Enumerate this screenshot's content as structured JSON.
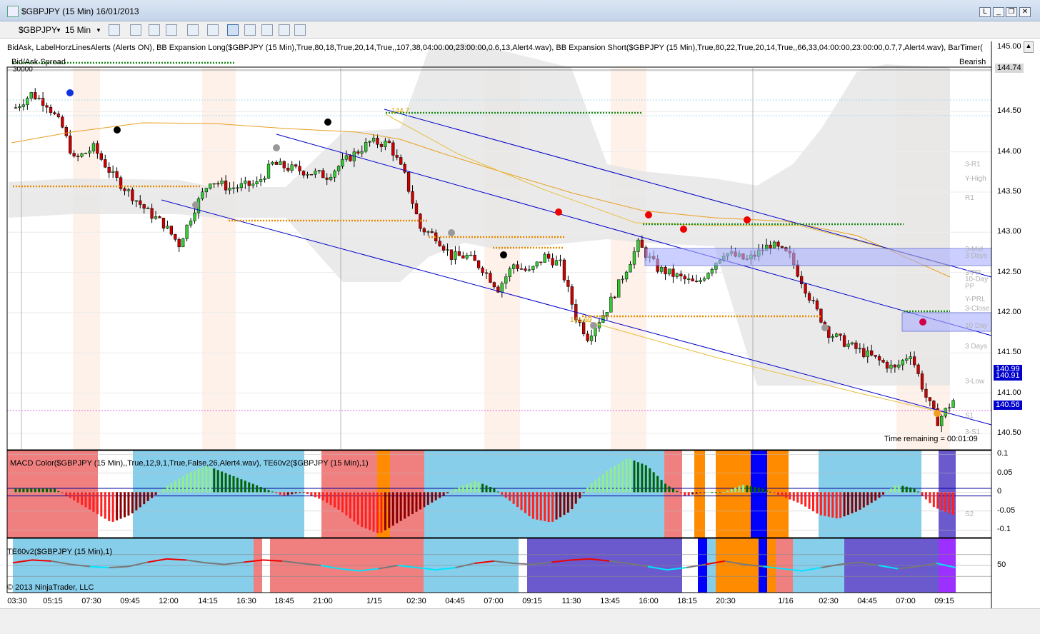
{
  "window": {
    "title": "$GBPJPY (15 Min)  16/01/2013",
    "controls": [
      "L",
      "_",
      "❐",
      "✕"
    ]
  },
  "toolbar": {
    "instrument": "$GBPJPY",
    "interval": "15 Min"
  },
  "chart_info": {
    "indicators": "BidAsk, LabelHorzLinesAlerts (Alerts ON), BB Expansion Long($GBPJPY (15 Min),True,80,18,True,20,14,True,,107,38,04:00:00,23:00:00,0.6,13,Alert4.wav), BB Expansion Short($GBPJPY (15 Min),True,80,22,True,20,14,True,,66,33,04:00:00,23:00:00,0.7,7,Alert4.wav), BarTimer(",
    "bidask_label": "Bid/Ask Spread",
    "bias_label": "Bearish",
    "overlay_value": "30000",
    "time_remaining": "Time remaining = 00:01:09",
    "macd_label": "MACD Color($GBPJPY (15 Min),,True,12,9,1,True,False,26,Alert4.wav), TE60v2($GBPJPY (15 Min),1)",
    "te_label": "TE60v2($GBPJPY (15 Min),1)",
    "copyright": "© 2013 NinjaTrader, LLC",
    "annotations": [
      {
        "text": "144.7",
        "series": "high"
      },
      {
        "text": "141.69",
        "series": "low"
      }
    ],
    "pivot_labels": [
      {
        "text": "3-R1",
        "price": 143.84
      },
      {
        "text": "Y-High",
        "price": 143.66
      },
      {
        "text": "R1",
        "price": 143.42
      },
      {
        "text": "3-Mid",
        "price": 142.78
      },
      {
        "text": "3 Days",
        "price": 142.7
      },
      {
        "text": "3-PP",
        "price": 142.49
      },
      {
        "text": "10-Day",
        "price": 142.41
      },
      {
        "text": "PP",
        "price": 142.32
      },
      {
        "text": "Y-PRL",
        "price": 142.16
      },
      {
        "text": "3-Close",
        "price": 142.04
      },
      {
        "text": "10 Day",
        "price": 141.83
      },
      {
        "text": "3 Days",
        "price": 141.57
      },
      {
        "text": "3-Low",
        "price": 141.14
      },
      {
        "text": "S1",
        "price": 140.71
      },
      {
        "text": "3-S1",
        "price": 140.51
      },
      {
        "text": "S2",
        "price": 139.49
      }
    ],
    "price_boxes": [
      {
        "text": "144.74",
        "style": "gray"
      },
      {
        "text": "140.99",
        "style": "blue"
      },
      {
        "text": "140.91",
        "style": "blue"
      },
      {
        "text": "140.56",
        "style": "blue"
      }
    ],
    "top_right_label": "145.00"
  },
  "chart_data": [
    {
      "type": "candlestick",
      "title": "$GBPJPY (15 Min)",
      "y_ticks": [
        "145.00",
        "144.50",
        "144.00",
        "143.50",
        "143.00",
        "142.50",
        "142.00",
        "141.50",
        "141.00",
        "140.50"
      ],
      "ylim": [
        140.25,
        145.0
      ],
      "x_ticks": [
        "03:30",
        "05:15",
        "07:30",
        "09:45",
        "12:00",
        "14:15",
        "16:30",
        "18:45",
        "21:00",
        "1/15",
        "02:30",
        "04:45",
        "07:00",
        "09:15",
        "11:30",
        "13:45",
        "16:00",
        "18:15",
        "20:30",
        "1/16",
        "02:30",
        "04:45",
        "07:00",
        "09:15"
      ],
      "close_path": [
        [
          0,
          144.55
        ],
        [
          4,
          144.72
        ],
        [
          8,
          144.6
        ],
        [
          12,
          144.3
        ],
        [
          15,
          143.9
        ],
        [
          20,
          144.05
        ],
        [
          25,
          143.7
        ],
        [
          30,
          143.45
        ],
        [
          34,
          143.25
        ],
        [
          38,
          143.1
        ],
        [
          42,
          142.85
        ],
        [
          46,
          143.3
        ],
        [
          50,
          143.65
        ],
        [
          55,
          143.55
        ],
        [
          62,
          143.6
        ],
        [
          66,
          143.85
        ],
        [
          70,
          143.8
        ],
        [
          75,
          143.75
        ],
        [
          80,
          143.7
        ],
        [
          85,
          143.9
        ],
        [
          91,
          144.12
        ],
        [
          96,
          144.1
        ],
        [
          100,
          143.7
        ],
        [
          104,
          143.05
        ],
        [
          108,
          142.95
        ],
        [
          112,
          142.7
        ],
        [
          116,
          142.7
        ],
        [
          120,
          142.55
        ],
        [
          124,
          142.3
        ],
        [
          128,
          142.6
        ],
        [
          132,
          142.5
        ],
        [
          136,
          142.7
        ],
        [
          140,
          142.6
        ],
        [
          144,
          141.95
        ],
        [
          147,
          141.7
        ],
        [
          152,
          142.05
        ],
        [
          156,
          142.45
        ],
        [
          160,
          142.85
        ],
        [
          165,
          142.55
        ],
        [
          170,
          142.45
        ],
        [
          175,
          142.35
        ],
        [
          182,
          142.75
        ],
        [
          188,
          142.65
        ],
        [
          194,
          142.85
        ],
        [
          199,
          142.7
        ],
        [
          205,
          142.1
        ],
        [
          209,
          141.75
        ],
        [
          214,
          141.6
        ],
        [
          220,
          141.45
        ],
        [
          226,
          141.3
        ],
        [
          230,
          141.5
        ],
        [
          234,
          140.95
        ],
        [
          237,
          140.65
        ],
        [
          241,
          140.91
        ]
      ],
      "overlays": {
        "sma_orange": "slow moving average",
        "bb_bands_gray": "volatility band",
        "regression_channel_blue": "two descending channels"
      }
    },
    {
      "type": "bar",
      "title": "MACD Color",
      "y_ticks": [
        "0.1",
        "0.05",
        "0",
        "-0.05",
        "-0.1"
      ],
      "ylim": [
        -0.12,
        0.11
      ],
      "values": [
        0.01,
        0.01,
        0.01,
        -0.02,
        -0.05,
        -0.08,
        -0.06,
        -0.02,
        0.02,
        0.05,
        0.07,
        0.05,
        0.03,
        0.01,
        -0.01,
        0.0,
        -0.02,
        -0.05,
        -0.09,
        -0.11,
        -0.08,
        -0.05,
        -0.02,
        0.01,
        0.03,
        0.01,
        -0.03,
        -0.07,
        -0.08,
        -0.05,
        0.02,
        0.06,
        0.09,
        0.07,
        0.02,
        -0.01,
        0.0,
        0.0,
        0.02,
        0.01,
        -0.01,
        -0.03,
        -0.06,
        -0.07,
        -0.05,
        -0.02,
        0.02,
        0.01,
        -0.04,
        -0.06
      ]
    },
    {
      "type": "line",
      "title": "TE60v2",
      "y_ticks": [
        "50"
      ],
      "values": [
        55,
        60,
        58,
        52,
        48,
        46,
        48,
        56,
        62,
        60,
        55,
        52,
        56,
        60,
        58,
        54,
        50,
        44,
        40,
        44,
        50,
        46,
        42,
        46,
        54,
        58,
        54,
        52,
        56,
        60,
        62,
        58,
        54,
        48,
        42,
        46,
        52,
        58,
        52,
        48,
        44,
        40,
        46,
        52,
        56,
        50,
        44,
        48,
        54,
        46
      ]
    }
  ]
}
